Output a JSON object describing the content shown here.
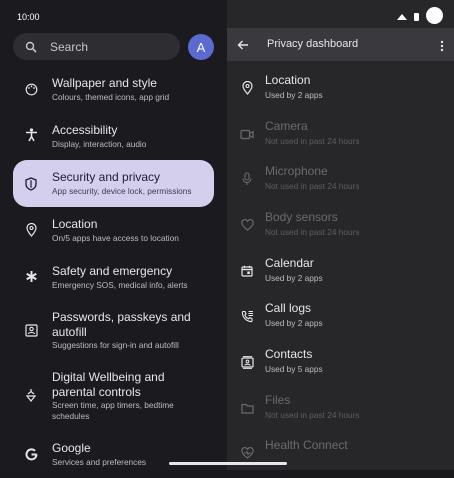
{
  "status_bar": {
    "time": "10:00"
  },
  "search": {
    "label": "Search",
    "account_initial": "A"
  },
  "settings_menu": [
    {
      "title": "Wallpaper and style",
      "subtitle": "Colours, themed icons, app grid",
      "icon": "palette-icon"
    },
    {
      "title": "Accessibility",
      "subtitle": "Display, interaction, audio",
      "icon": "accessibility-icon"
    },
    {
      "title": "Security and privacy",
      "subtitle": "App security, device lock, permissions",
      "icon": "shield-icon",
      "selected": true
    },
    {
      "title": "Location",
      "subtitle": "On/5 apps have access to location",
      "icon": "location-pin-icon"
    },
    {
      "title": "Safety and emergency",
      "subtitle": "Emergency SOS, medical info, alerts",
      "icon": "asterisk-icon"
    },
    {
      "title1": "Passwords, passkeys and",
      "title2": "autofill",
      "subtitle": "Suggestions for sign-in and autofill",
      "icon": "person-card-icon"
    },
    {
      "title1": "Digital Wellbeing and",
      "title2": "parental controls",
      "subtitle1": "Screen time, app timers, bedtime",
      "subtitle2": "schedules",
      "icon": "wellbeing-icon"
    },
    {
      "title": "Google",
      "subtitle": "Services and preferences",
      "icon": "google-icon"
    }
  ],
  "privacy_dashboard": {
    "header_title": "Privacy dashboard",
    "items": [
      {
        "title": "Location",
        "subtitle": "Used by 2 apps",
        "icon": "location-pin-icon",
        "enabled": true
      },
      {
        "title": "Camera",
        "subtitle": "Not used in past 24 hours",
        "icon": "camera-icon",
        "enabled": false
      },
      {
        "title": "Microphone",
        "subtitle": "Not used in past 24 hours",
        "icon": "microphone-icon",
        "enabled": false
      },
      {
        "title": "Body sensors",
        "subtitle": "Not used in past 24 hours",
        "icon": "heart-icon",
        "enabled": false
      },
      {
        "title": "Calendar",
        "subtitle": "Used by 2 apps",
        "icon": "calendar-icon",
        "enabled": true
      },
      {
        "title": "Call logs",
        "subtitle": "Used by 2 apps",
        "icon": "call-log-icon",
        "enabled": true
      },
      {
        "title": "Contacts",
        "subtitle": "Used by 5 apps",
        "icon": "contacts-icon",
        "enabled": true
      },
      {
        "title": "Files",
        "subtitle": "Not used in past 24 hours",
        "icon": "folder-icon",
        "enabled": false
      },
      {
        "title": "Health Connect",
        "subtitle": "",
        "icon": "health-icon",
        "enabled": false
      }
    ]
  }
}
